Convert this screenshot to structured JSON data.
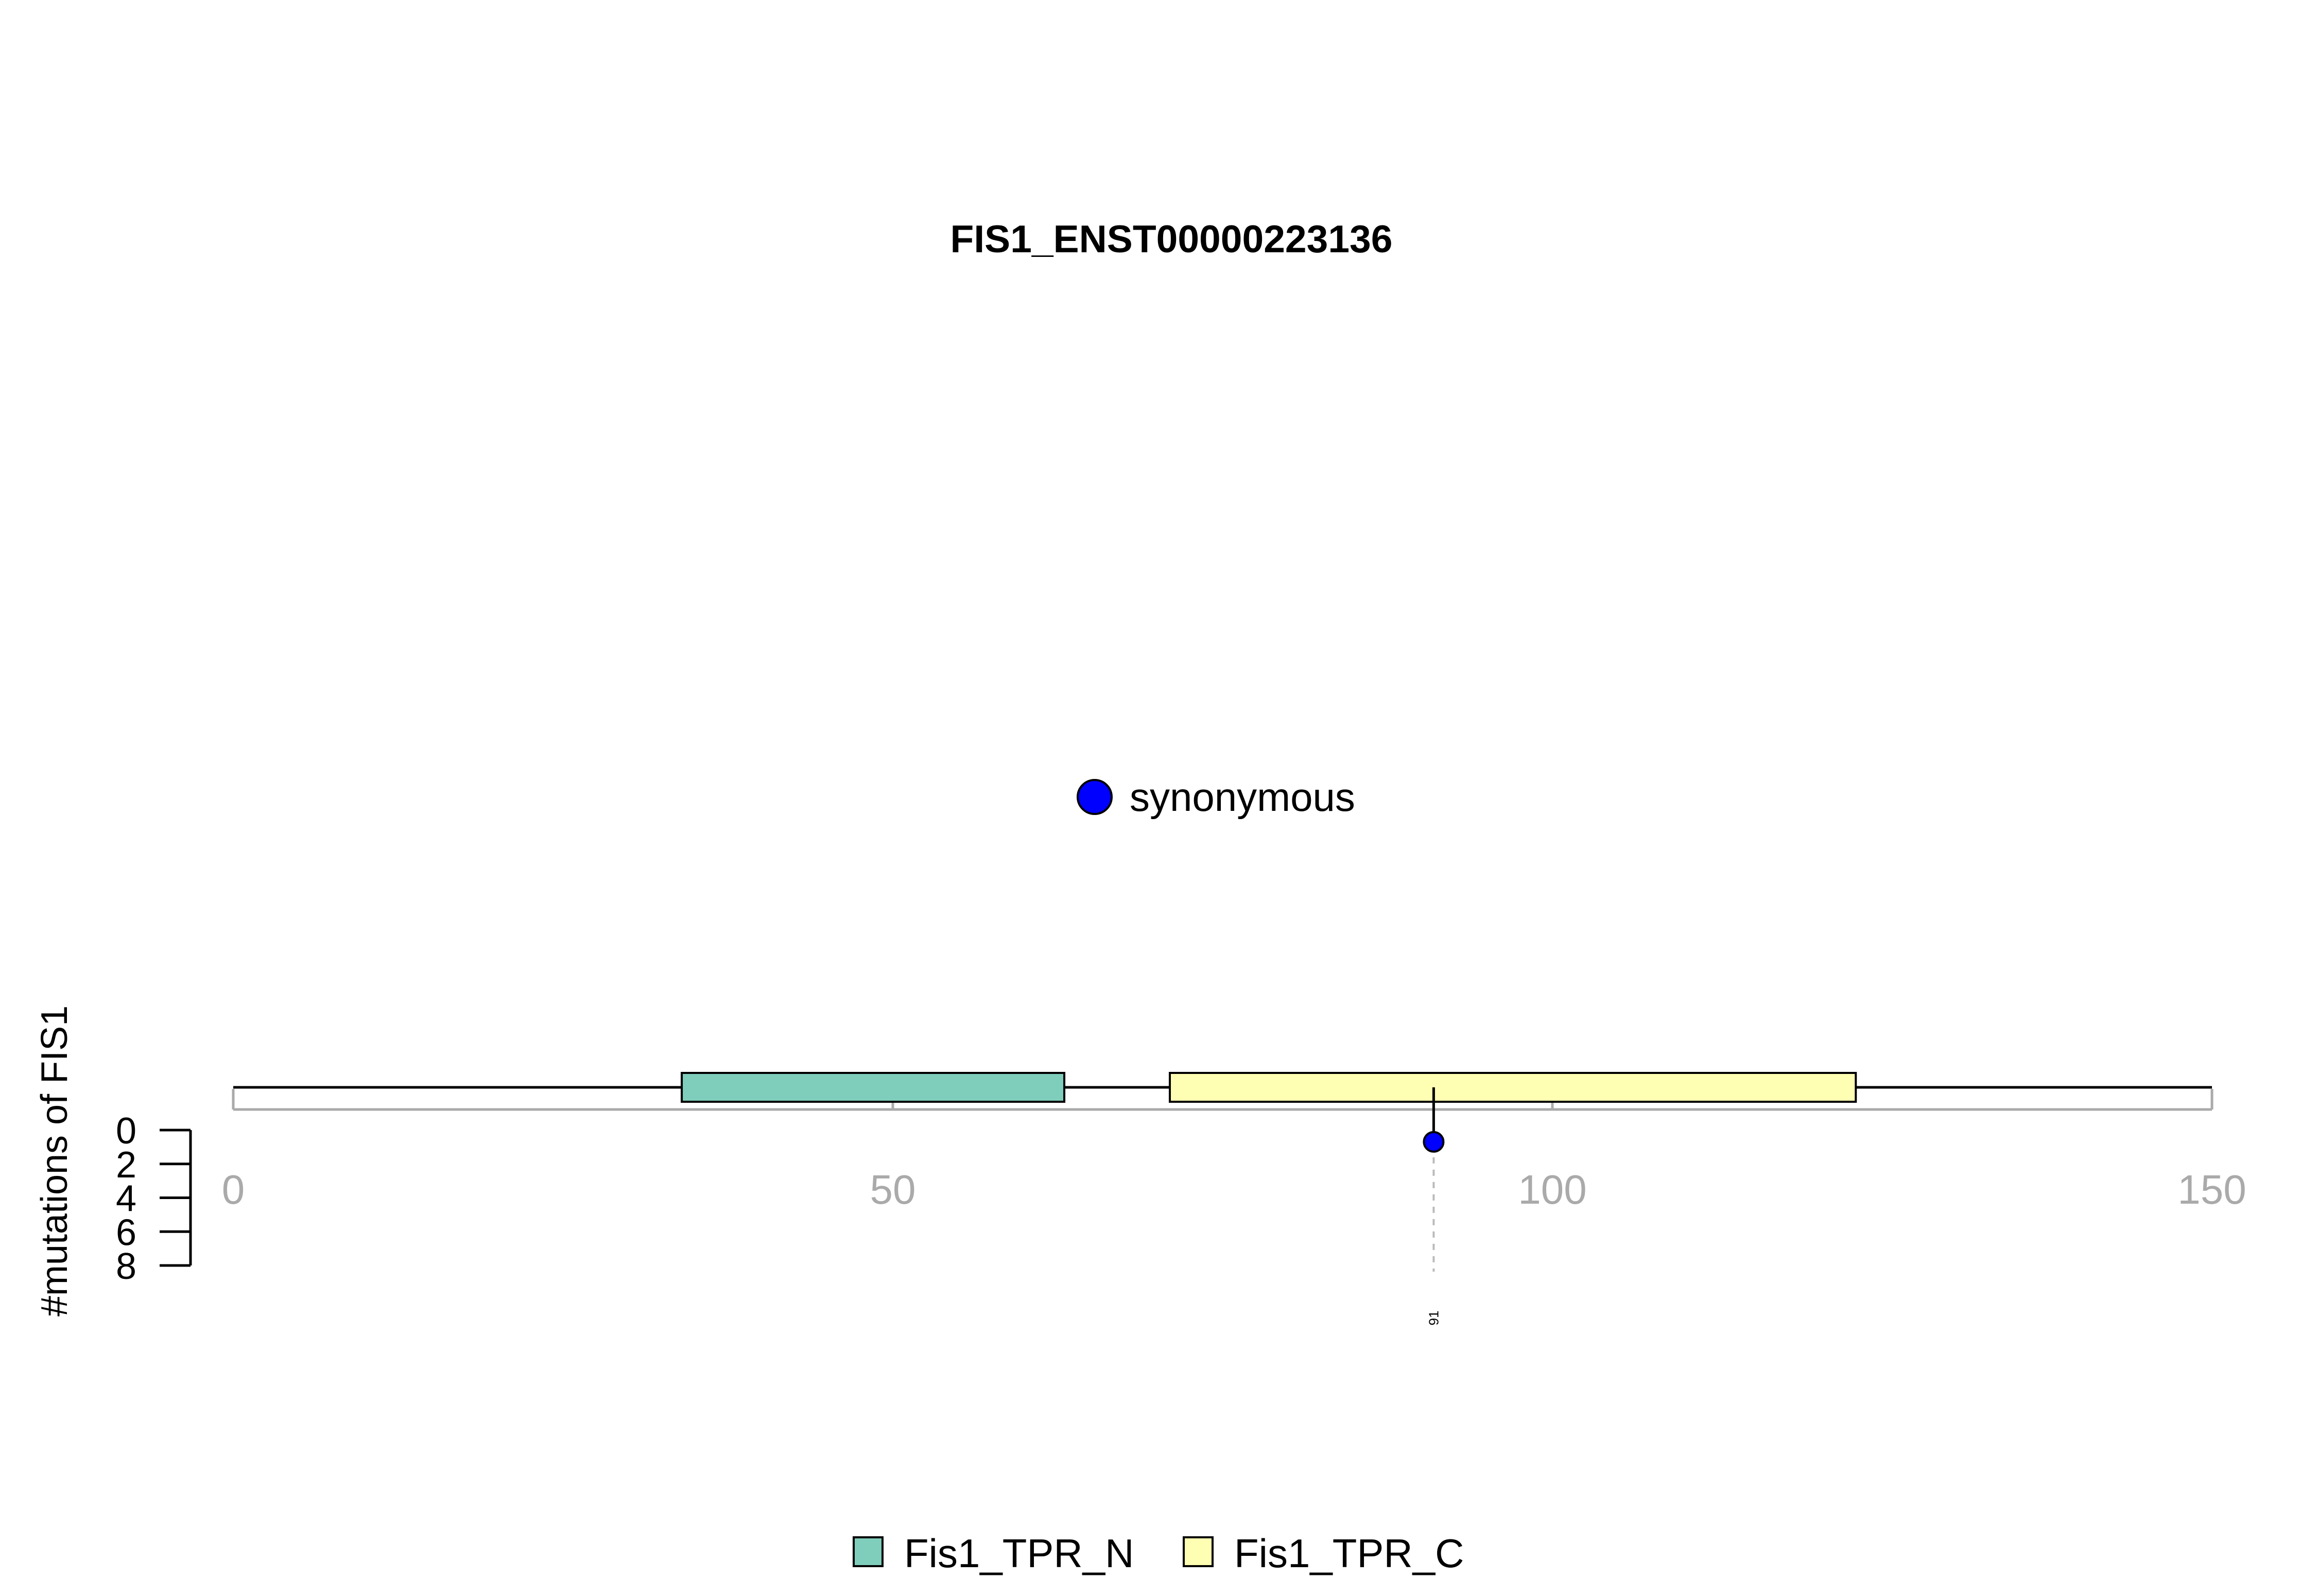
{
  "chart_data": {
    "type": "lollipop",
    "title": "FIS1_ENST00000223136",
    "x_axis": {
      "range": [
        0,
        150
      ],
      "ticks": [
        0,
        50,
        100,
        150
      ]
    },
    "y_axis": {
      "label": "#mutations of FIS1",
      "ticks": [
        0,
        2,
        4,
        6,
        8
      ],
      "range": [
        0,
        8
      ]
    },
    "protein_length": 150,
    "domains": [
      {
        "name": "Fis1_TPR_N",
        "start": 34,
        "end": 63,
        "color": "#7FCDBB"
      },
      {
        "name": "Fis1_TPR_C",
        "start": 71,
        "end": 123,
        "color": "#FFFFB3"
      }
    ],
    "mutations": [
      {
        "position": 91,
        "count": 1,
        "type": "synonymous",
        "label": "91"
      }
    ],
    "mutation_legend": [
      {
        "type": "synonymous",
        "color": "#0000FF"
      }
    ],
    "domain_legend_placement": "bottom",
    "mutation_legend_placement": "top"
  }
}
